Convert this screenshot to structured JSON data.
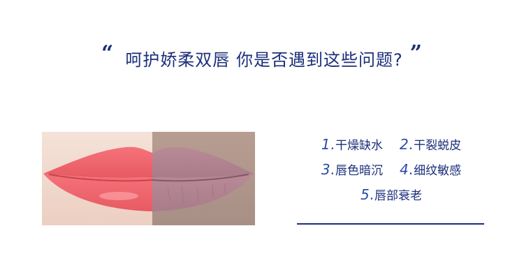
{
  "headline": {
    "open_quote": "“",
    "text": "呵护娇柔双唇 你是否遇到这些问题?",
    "close_quote": "”"
  },
  "issues": [
    {
      "num": "1",
      "label": "干燥缺水"
    },
    {
      "num": "2",
      "label": "干裂蜕皮"
    },
    {
      "num": "3",
      "label": "唇色暗沉"
    },
    {
      "num": "4",
      "label": "细纹敏感"
    },
    {
      "num": "5",
      "label": "唇部衰老"
    }
  ],
  "colors": {
    "accent": "#1b2f7a",
    "healthy_lip": "#f06a6e",
    "dull_lip": "#b98a96"
  }
}
